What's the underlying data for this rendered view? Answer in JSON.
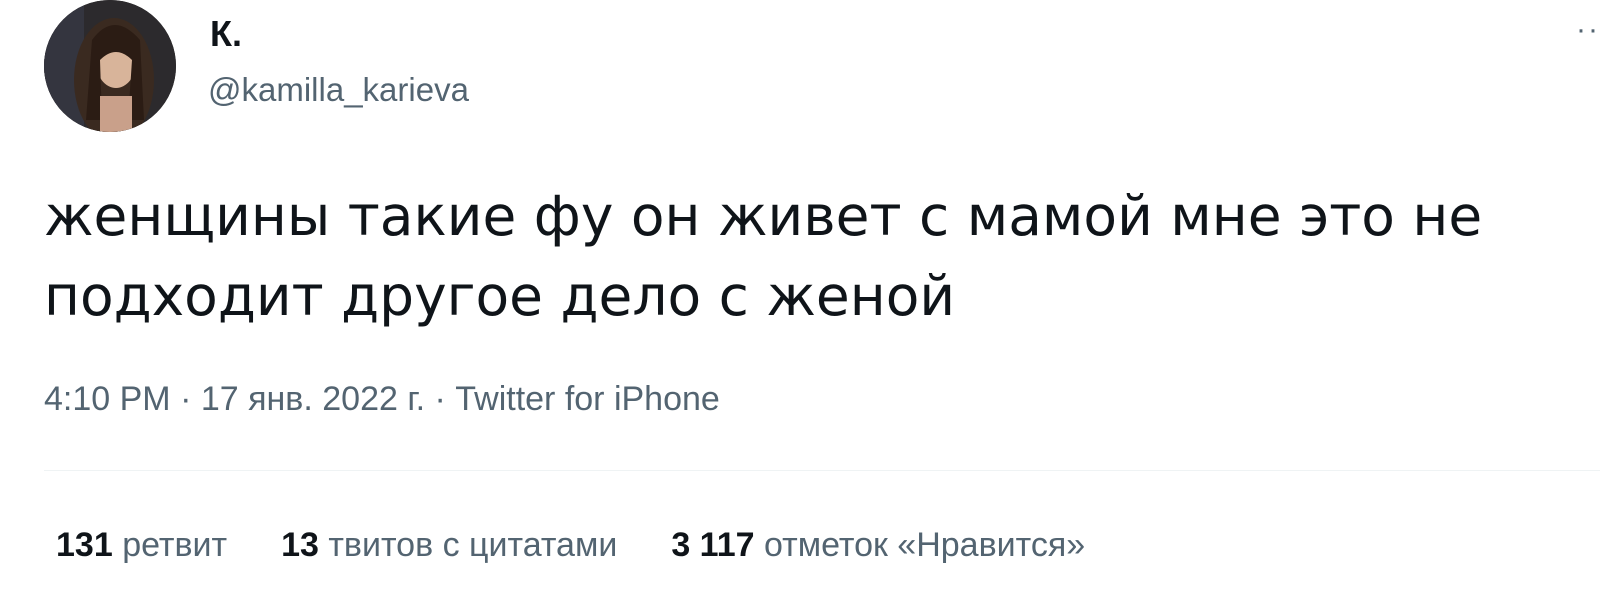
{
  "author": {
    "name": "К.",
    "handle": "@kamilla_karieva"
  },
  "tweet": {
    "text": "женщины такие фу он живет с мамой мне это не подходит другое дело с женой"
  },
  "meta": {
    "time": "4:10 PM",
    "separator": " · ",
    "date": "17 янв. 2022 г.",
    "source": "Twitter for iPhone"
  },
  "stats": {
    "retweets": {
      "count": "131",
      "label": "ретвит"
    },
    "quotes": {
      "count": "13",
      "label": "твитов с цитатами"
    },
    "likes": {
      "count": "3 117",
      "label": "отметок «Нравится»"
    }
  },
  "icons": {
    "more": "more-dots-icon"
  },
  "colors": {
    "text_primary": "#0f1419",
    "text_secondary": "#536471",
    "divider": "#eff3f4"
  }
}
